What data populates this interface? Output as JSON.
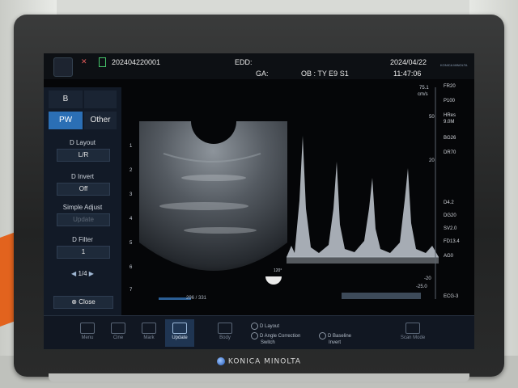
{
  "header": {
    "patient_id": "202404220001",
    "edd_label": "EDD:",
    "ga_label": "GA:",
    "exam": "OB : TY E9 S1",
    "date": "2024/04/22",
    "time": "11:47:06",
    "brand_small": "KONICA MINOLTA"
  },
  "left_panel": {
    "mode_tab": "B",
    "tabs": [
      "PW",
      "Other"
    ],
    "controls": [
      {
        "label": "D Layout",
        "value": "L/R",
        "dim": false
      },
      {
        "label": "D Invert",
        "value": "Off",
        "dim": false
      },
      {
        "label": "Simple Adjust",
        "value": "Update",
        "dim": true
      },
      {
        "label": "D Filter",
        "value": "1",
        "dim": false
      }
    ],
    "page": "1/4",
    "close_label": "Close"
  },
  "image": {
    "depth_ticks": [
      "1",
      "2",
      "3",
      "4",
      "5",
      "6",
      "7"
    ],
    "frame_counter": "296 / 331",
    "velocity_top": "75.1",
    "velocity_unit": "cm/s",
    "velocity_bottom": "-25.0",
    "scale_labels": [
      "50",
      "20",
      "-20"
    ],
    "probe_label": "120°"
  },
  "right_params": [
    "FR20",
    "P100",
    "HRes",
    "9.0M",
    "BG26",
    "DR70",
    "D4.2",
    "DG20",
    "SV2.0",
    "FD13.4",
    "AG0",
    "ECG-3"
  ],
  "toolbar": {
    "buttons": [
      {
        "label": "Menu",
        "active": false
      },
      {
        "label": "Cine",
        "active": false
      },
      {
        "label": "Mark",
        "active": false
      },
      {
        "label": "Update",
        "active": true
      },
      {
        "label": "Body",
        "active": false
      }
    ],
    "group1": [
      "D Layout"
    ],
    "group2": [
      "D Angle Correction",
      "Switch"
    ],
    "group3": [
      "D Baseline",
      "Invert"
    ],
    "right_label": "Scan Mode"
  },
  "brand": "KONICA MINOLTA"
}
